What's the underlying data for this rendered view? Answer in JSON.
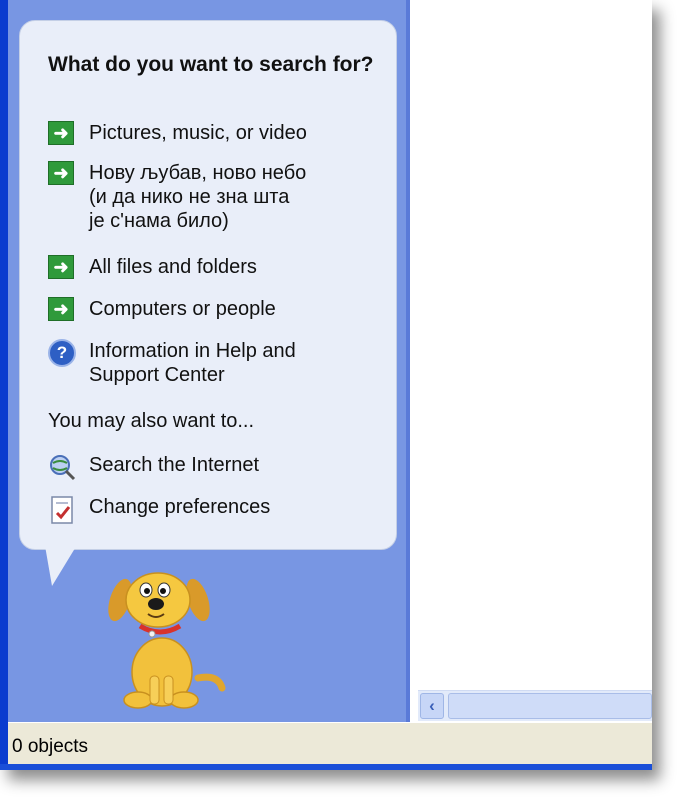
{
  "search_companion": {
    "question": "What do you want to search for?",
    "items": [
      {
        "label": "Pictures, music, or video",
        "icon": "green-arrow-icon"
      },
      {
        "label": "Нову љубав, ново небо\n(и да нико не зна шта\nје с'нама било)",
        "icon": "green-arrow-icon"
      },
      {
        "label": "All files and folders",
        "icon": "green-arrow-icon"
      },
      {
        "label": "Computers or people",
        "icon": "green-arrow-icon"
      },
      {
        "label": "Information in Help and\nSupport Center",
        "icon": "help-icon"
      }
    ],
    "also_heading": "You may also want to...",
    "also_items": [
      {
        "label": "Search the Internet",
        "icon": "search-globe-icon"
      },
      {
        "label": "Change preferences",
        "icon": "preferences-icon"
      }
    ]
  },
  "status_bar": {
    "text": "0 objects"
  },
  "colors": {
    "pane": "#7896e3",
    "bubble": "#e9eef9",
    "arrow_green": "#2f9a3b",
    "window_border": "#0a3ccf"
  }
}
